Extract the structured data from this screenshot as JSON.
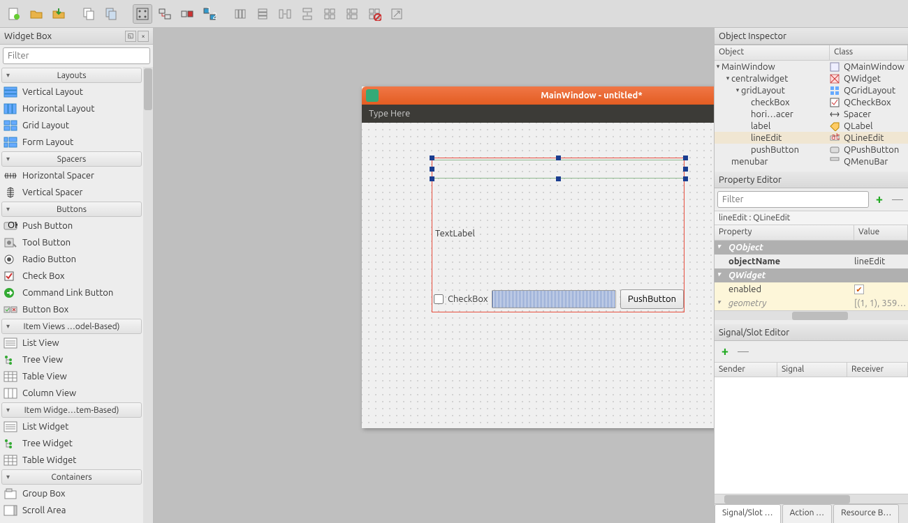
{
  "toolbar": {
    "icons": [
      "new-file",
      "open-file",
      "save-file",
      "",
      "copy",
      "paste",
      "",
      "edit-widgets",
      "edit-signals",
      "edit-buddies",
      "edit-tab-order",
      "",
      "layout-h",
      "layout-v",
      "layout-hs",
      "layout-vs",
      "layout-grid",
      "layout-form",
      "break-layout",
      "adjust-size"
    ]
  },
  "widgetBox": {
    "title": "Widget Box",
    "filter_placeholder": "Filter",
    "categories": [
      {
        "name": "Layouts",
        "items": [
          "Vertical Layout",
          "Horizontal Layout",
          "Grid Layout",
          "Form Layout"
        ]
      },
      {
        "name": "Spacers",
        "items": [
          "Horizontal Spacer",
          "Vertical Spacer"
        ]
      },
      {
        "name": "Buttons",
        "items": [
          "Push Button",
          "Tool Button",
          "Radio Button",
          "Check Box",
          "Command Link Button",
          "Button Box"
        ]
      },
      {
        "name": "Item Views …odel-Based)",
        "items": [
          "List View",
          "Tree View",
          "Table View",
          "Column View"
        ]
      },
      {
        "name": "Item Widge…tem-Based)",
        "items": [
          "List Widget",
          "Tree Widget",
          "Table Widget"
        ]
      },
      {
        "name": "Containers",
        "items": [
          "Group Box",
          "Scroll Area"
        ]
      }
    ]
  },
  "formWindow": {
    "title": "MainWindow - untitled*",
    "menubar_hint": "Type Here",
    "label_text": "TextLabel",
    "checkbox_label": "CheckBox",
    "pushbutton_label": "PushButton"
  },
  "objectInspector": {
    "title": "Object Inspector",
    "columns": [
      "Object",
      "Class"
    ],
    "rows": [
      {
        "indent": 0,
        "arrow": "▾",
        "name": "MainWindow",
        "class": "QMainWindow",
        "icon": "window"
      },
      {
        "indent": 1,
        "arrow": "▾",
        "name": "centralwidget",
        "class": "QWidget",
        "icon": "widget"
      },
      {
        "indent": 2,
        "arrow": "▾",
        "name": "gridLayout",
        "class": "QGridLayout",
        "icon": "grid"
      },
      {
        "indent": 3,
        "arrow": "",
        "name": "checkBox",
        "class": "QCheckBox",
        "icon": "check"
      },
      {
        "indent": 3,
        "arrow": "",
        "name": "hori…acer",
        "class": "Spacer",
        "icon": "spacer"
      },
      {
        "indent": 3,
        "arrow": "",
        "name": "label",
        "class": "QLabel",
        "icon": "label"
      },
      {
        "indent": 3,
        "arrow": "",
        "name": "lineEdit",
        "class": "QLineEdit",
        "icon": "lineedit",
        "sel": true
      },
      {
        "indent": 3,
        "arrow": "",
        "name": "pushButton",
        "class": "QPushButton",
        "icon": "button"
      },
      {
        "indent": 1,
        "arrow": "",
        "name": "menubar",
        "class": "QMenuBar",
        "icon": "menubar"
      }
    ]
  },
  "propertyEditor": {
    "title": "Property Editor",
    "filter_placeholder": "Filter",
    "context": "lineEdit : QLineEdit",
    "columns": [
      "Property",
      "Value"
    ],
    "rows": [
      {
        "type": "cat",
        "name": "QObject"
      },
      {
        "type": "prop",
        "name": "objectName",
        "value": "lineEdit",
        "bold": true
      },
      {
        "type": "cat",
        "name": "QWidget"
      },
      {
        "type": "prop",
        "name": "enabled",
        "value": "✓",
        "yel": true,
        "check": true
      },
      {
        "type": "prop",
        "name": "geometry",
        "value": "[(1, 1), 359…",
        "yel": true,
        "italic": true,
        "arrow": "▾"
      }
    ]
  },
  "signalSlot": {
    "title": "Signal/Slot Editor",
    "columns": [
      "Sender",
      "Signal",
      "Receiver"
    ]
  },
  "bottomTabs": [
    "Signal/Slot …",
    "Action …",
    "Resource B…"
  ]
}
